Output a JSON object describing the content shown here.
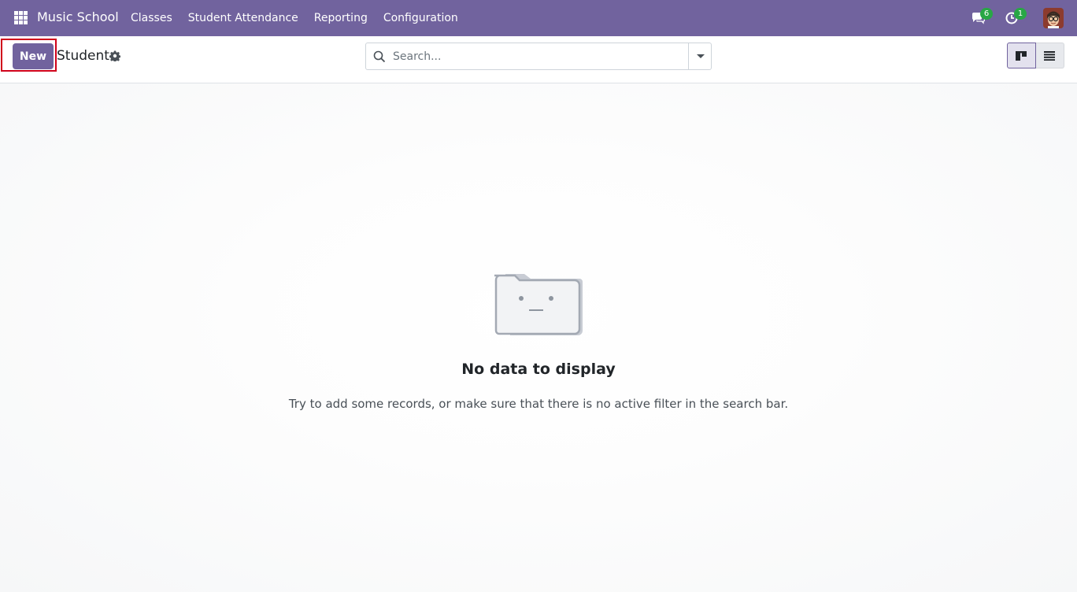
{
  "navbar": {
    "brand": "Music School",
    "menu": [
      "Classes",
      "Student Attendance",
      "Reporting",
      "Configuration"
    ],
    "messages_badge": "6",
    "activities_badge": "1",
    "accent_color": "#71639e",
    "badge_color": "#28a745"
  },
  "control_panel": {
    "new_label": "New",
    "breadcrumb": "Student",
    "search_placeholder": "Search...",
    "views": [
      "kanban-view",
      "list-view"
    ],
    "active_view": "kanban-view",
    "highlight_color": "#d0021b"
  },
  "empty_state": {
    "title": "No data to display",
    "description": "Try to add some records, or make sure that there is no active filter in the search bar."
  }
}
